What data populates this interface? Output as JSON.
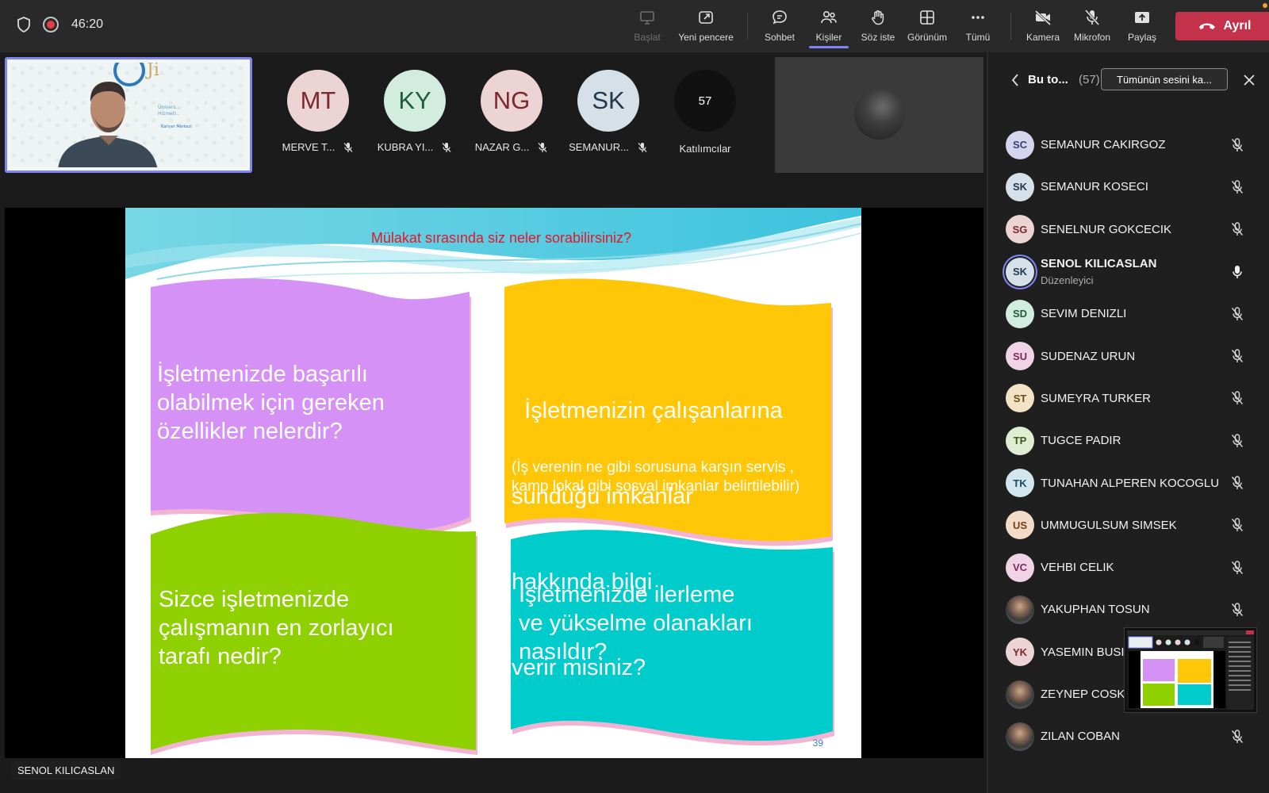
{
  "topbar": {
    "timer": "46:20",
    "buttons": [
      {
        "label": "Başlat"
      },
      {
        "label": "Yeni pencere"
      },
      {
        "label": "Sohbet"
      },
      {
        "label": "Kişiler"
      },
      {
        "label": "Söz iste"
      },
      {
        "label": "Görünüm"
      },
      {
        "label": "Tümü"
      },
      {
        "label": "Kamera"
      },
      {
        "label": "Mikrofon"
      },
      {
        "label": "Paylaş"
      }
    ],
    "leave_label": "Ayrıl"
  },
  "gallery": {
    "tiles": [
      {
        "initials": "MT",
        "name": "MERVE T...",
        "bg": "#ecd3d4",
        "fg": "#7a2a2f"
      },
      {
        "initials": "KY",
        "name": "KUBRA YI...",
        "bg": "#d2ede0",
        "fg": "#1f5b3d"
      },
      {
        "initials": "NG",
        "name": "NAZAR G...",
        "bg": "#ecd3d4",
        "fg": "#7a2a2f"
      },
      {
        "initials": "SK",
        "name": "SEMANUR...",
        "bg": "#d5e0e8",
        "fg": "#23384a"
      }
    ],
    "count": "57",
    "count_label": "Katılımcılar"
  },
  "slide": {
    "title": "Mülakat sırasında siz neler sorabilirsiniz?",
    "card1": [
      "İşletmenizde başarılı",
      "olabilmek için gereken",
      "özellikler nelerdir?"
    ],
    "card2": [
      "  İşletmenizin çalışanlarına",
      "sunduğu imkanlar",
      "hakkında bilgi",
      "verir misiniz?"
    ],
    "card2_note": [
      "(İş verenin ne gibi sorusuna karşın servis ,",
      "kamp lokal gibi sosyal imkanlar belirtilebilir)"
    ],
    "card3": [
      "Sizce işletmenizde",
      "çalışmanın en zorlayıcı",
      "tarafı nedir?"
    ],
    "card4": [
      "İşletmenizde ilerleme",
      "ve yükselme olanakları",
      "nasıldır?"
    ],
    "page": "39"
  },
  "speaker_label": "SENOL KILICASLAN",
  "panel": {
    "title": "Bu to...",
    "count": "(57)",
    "mute_all": "Tümünün sesini ka...",
    "participants": [
      {
        "initials": "SC",
        "name": "SEMANUR CAKIRGOZ",
        "bg": "#d5d6ee",
        "fg": "#3b3d7a",
        "mic": "off"
      },
      {
        "initials": "SK",
        "name": "SEMANUR KOSECI",
        "bg": "#d5e0e8",
        "fg": "#23384a",
        "mic": "off"
      },
      {
        "initials": "SG",
        "name": "SENELNUR GOKCECIK",
        "bg": "#ecd3d4",
        "fg": "#7a2a2f",
        "mic": "off"
      },
      {
        "initials": "SK",
        "name": "SENOL KILICASLAN",
        "role": "Düzenleyici",
        "bg": "#d5e0e8",
        "fg": "#23384a",
        "mic": "on",
        "selected": true
      },
      {
        "initials": "SD",
        "name": "SEVIM DENIZLI",
        "bg": "#d2ede0",
        "fg": "#1f5b3d",
        "mic": "off"
      },
      {
        "initials": "SU",
        "name": "SUDENAZ URUN",
        "bg": "#f0d4e6",
        "fg": "#7d2a5e",
        "mic": "off"
      },
      {
        "initials": "ST",
        "name": "SUMEYRA TURKER",
        "bg": "#f2e2c6",
        "fg": "#6e4a14",
        "mic": "off"
      },
      {
        "initials": "TP",
        "name": "TUGCE PADIR",
        "bg": "#dfeed2",
        "fg": "#3a5a1c",
        "mic": "off"
      },
      {
        "initials": "TK",
        "name": "TUNAHAN ALPEREN KOCOGLU",
        "bg": "#d2e6ee",
        "fg": "#1d4a5e",
        "mic": "off"
      },
      {
        "initials": "US",
        "name": "UMMUGULSUM SIMSEK",
        "bg": "#f2dcc8",
        "fg": "#7a3e14",
        "mic": "off"
      },
      {
        "initials": "VC",
        "name": "VEHBI CELIK",
        "bg": "#f0d4e6",
        "fg": "#7d2a5e",
        "mic": "off"
      },
      {
        "initials": "",
        "name": "YAKUPHAN TOSUN",
        "photo": true,
        "mic": "off"
      },
      {
        "initials": "YK",
        "name": "YASEMIN BUSI",
        "bg": "#ecd3d4",
        "fg": "#7a2a2f",
        "mic": "none"
      },
      {
        "initials": "",
        "name": "ZEYNEP COSK",
        "photo": true,
        "mic": "none"
      },
      {
        "initials": "",
        "name": "ZILAN COBAN",
        "photo": true,
        "mic": "off"
      }
    ]
  },
  "colors": {
    "accent": "#7f85f5",
    "leave": "#c4314b",
    "card_purple": "#d691f7",
    "card_orange": "#ffc708",
    "card_green": "#8fd100",
    "card_cyan": "#00cccc"
  }
}
